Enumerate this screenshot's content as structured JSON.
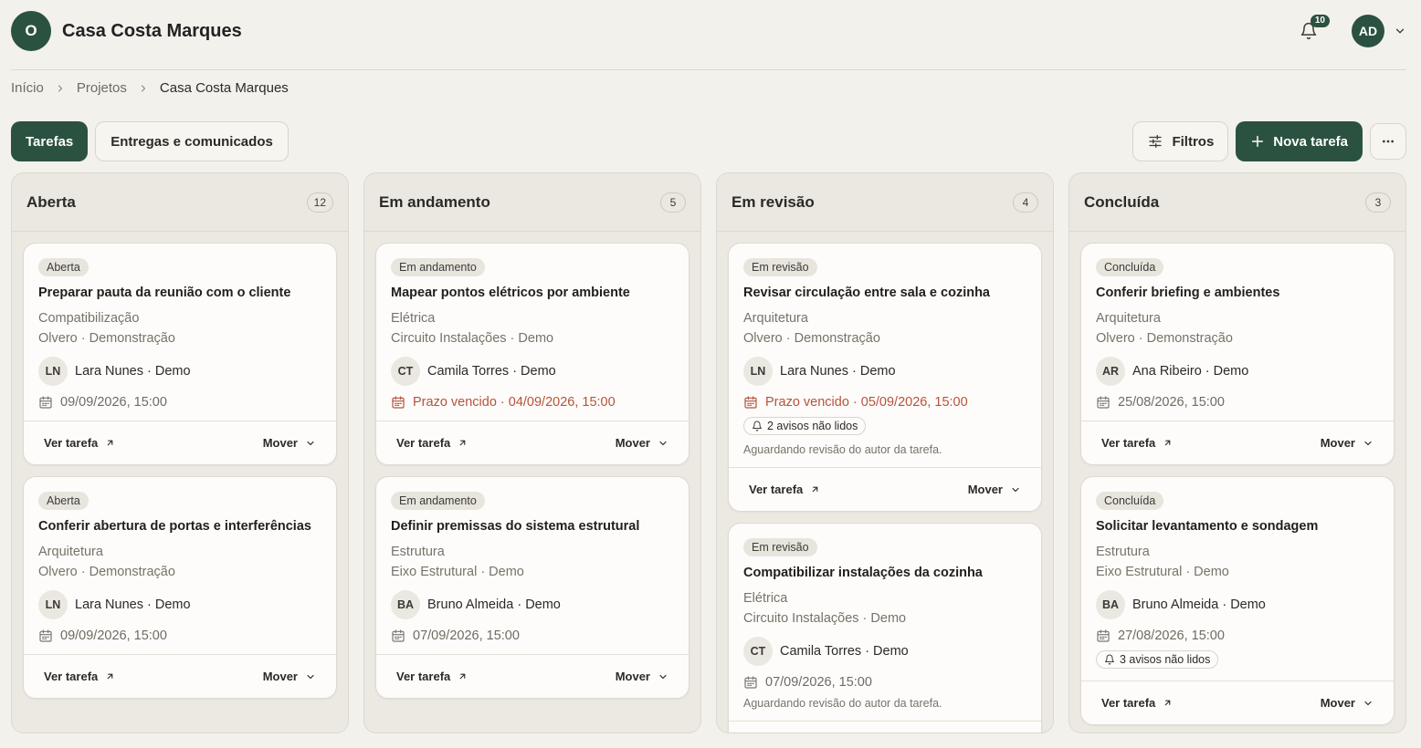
{
  "header": {
    "logo_letter": "O",
    "title": "Casa Costa Marques",
    "notification_count": "10",
    "user_initials": "AD"
  },
  "breadcrumb": [
    "Início",
    "Projetos",
    "Casa Costa Marques"
  ],
  "tabs": [
    {
      "label": "Tarefas",
      "active": true
    },
    {
      "label": "Entregas e comunicados",
      "active": false
    }
  ],
  "actions": {
    "filters_label": "Filtros",
    "new_task_label": "Nova tarefa"
  },
  "card_actions": {
    "view": "Ver tarefa",
    "move": "Mover"
  },
  "colors": {
    "accent": "#2b5141",
    "overdue": "#b5533a",
    "background": "#f3f1ec"
  },
  "columns": [
    {
      "title": "Aberta",
      "count": "12",
      "cards": [
        {
          "status": "Aberta",
          "title": "Preparar pauta da reunião com o cliente",
          "discipline": "Compatibilização",
          "team": "Olvero · Demonstração",
          "initials": "LN",
          "assignee": "Lara Nunes · Demo",
          "due": "09/09/2026, 15:00",
          "overdue": false,
          "notices": "",
          "waiting": ""
        },
        {
          "status": "Aberta",
          "title": "Conferir abertura de portas e interferências",
          "discipline": "Arquitetura",
          "team": "Olvero · Demonstração",
          "initials": "LN",
          "assignee": "Lara Nunes · Demo",
          "due": "09/09/2026, 15:00",
          "overdue": false,
          "notices": "",
          "waiting": ""
        }
      ]
    },
    {
      "title": "Em andamento",
      "count": "5",
      "cards": [
        {
          "status": "Em andamento",
          "title": "Mapear pontos elétricos por ambiente",
          "discipline": "Elétrica",
          "team": "Circuito Instalações · Demo",
          "initials": "CT",
          "assignee": "Camila Torres · Demo",
          "due": "Prazo vencido · 04/09/2026, 15:00",
          "overdue": true,
          "notices": "",
          "waiting": ""
        },
        {
          "status": "Em andamento",
          "title": "Definir premissas do sistema estrutural",
          "discipline": "Estrutura",
          "team": "Eixo Estrutural · Demo",
          "initials": "BA",
          "assignee": "Bruno Almeida · Demo",
          "due": "07/09/2026, 15:00",
          "overdue": false,
          "notices": "",
          "waiting": ""
        }
      ]
    },
    {
      "title": "Em revisão",
      "count": "4",
      "cards": [
        {
          "status": "Em revisão",
          "title": "Revisar circulação entre sala e cozinha",
          "discipline": "Arquitetura",
          "team": "Olvero · Demonstração",
          "initials": "LN",
          "assignee": "Lara Nunes · Demo",
          "due": "Prazo vencido · 05/09/2026, 15:00",
          "overdue": true,
          "notices": "2 avisos não lidos",
          "waiting": "Aguardando revisão do autor da tarefa."
        },
        {
          "status": "Em revisão",
          "title": "Compatibilizar instalações da cozinha",
          "discipline": "Elétrica",
          "team": "Circuito Instalações · Demo",
          "initials": "CT",
          "assignee": "Camila Torres · Demo",
          "due": "07/09/2026, 15:00",
          "overdue": false,
          "notices": "",
          "waiting": "Aguardando revisão do autor da tarefa."
        }
      ]
    },
    {
      "title": "Concluída",
      "count": "3",
      "cards": [
        {
          "status": "Concluída",
          "title": "Conferir briefing e ambientes",
          "discipline": "Arquitetura",
          "team": "Olvero · Demonstração",
          "initials": "AR",
          "assignee": "Ana Ribeiro · Demo",
          "due": "25/08/2026, 15:00",
          "overdue": false,
          "notices": "",
          "waiting": ""
        },
        {
          "status": "Concluída",
          "title": "Solicitar levantamento e sondagem",
          "discipline": "Estrutura",
          "team": "Eixo Estrutural · Demo",
          "initials": "BA",
          "assignee": "Bruno Almeida · Demo",
          "due": "27/08/2026, 15:00",
          "overdue": false,
          "notices": "3 avisos não lidos",
          "waiting": ""
        }
      ]
    }
  ]
}
